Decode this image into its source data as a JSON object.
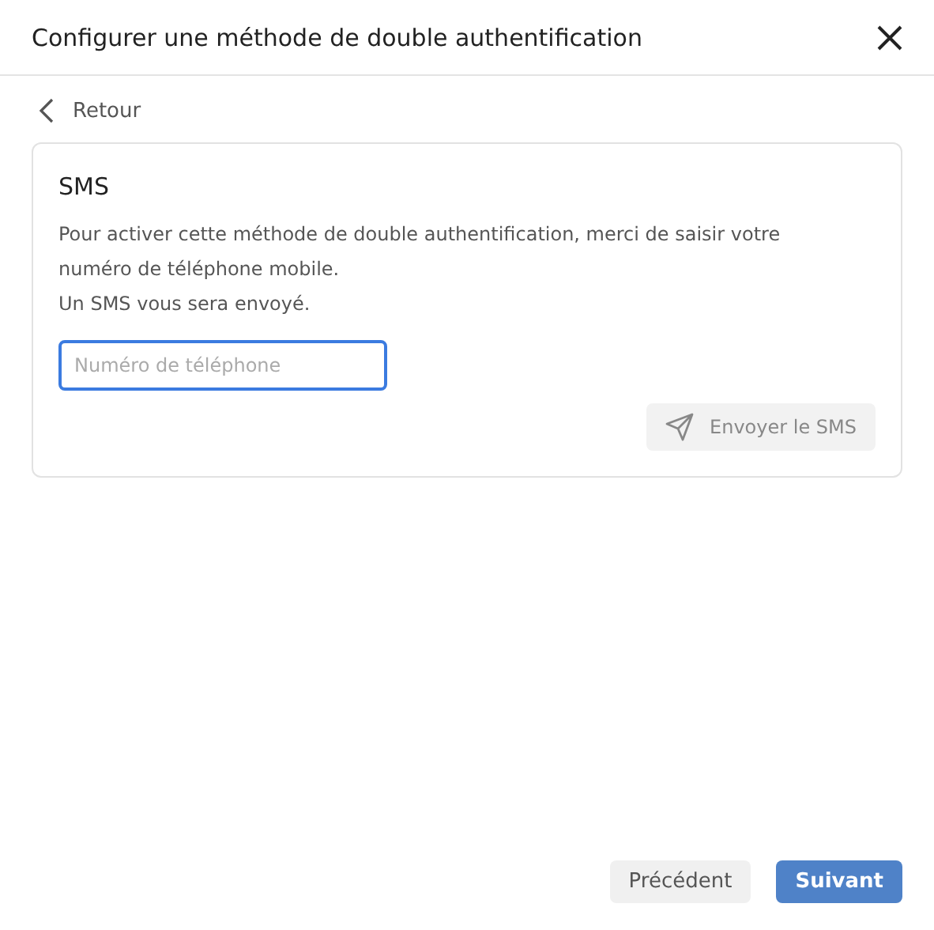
{
  "dialog": {
    "title": "Configurer une méthode de double authentification"
  },
  "back_link": {
    "label": "Retour"
  },
  "card": {
    "title": "SMS",
    "paragraphs": [
      "Pour activer cette méthode de double authentification, merci de saisir votre numéro de téléphone mobile.",
      "Un SMS vous sera envoyé."
    ],
    "phone_field": {
      "placeholder": "Numéro de téléphone",
      "focused": true
    },
    "send_button": {
      "label": "Envoyer le SMS",
      "disabled": true
    }
  },
  "footer": {
    "buttons": [
      {
        "label": "Précédent",
        "kind": "secondary"
      },
      {
        "label": "Suivant",
        "kind": "primary"
      }
    ]
  }
}
